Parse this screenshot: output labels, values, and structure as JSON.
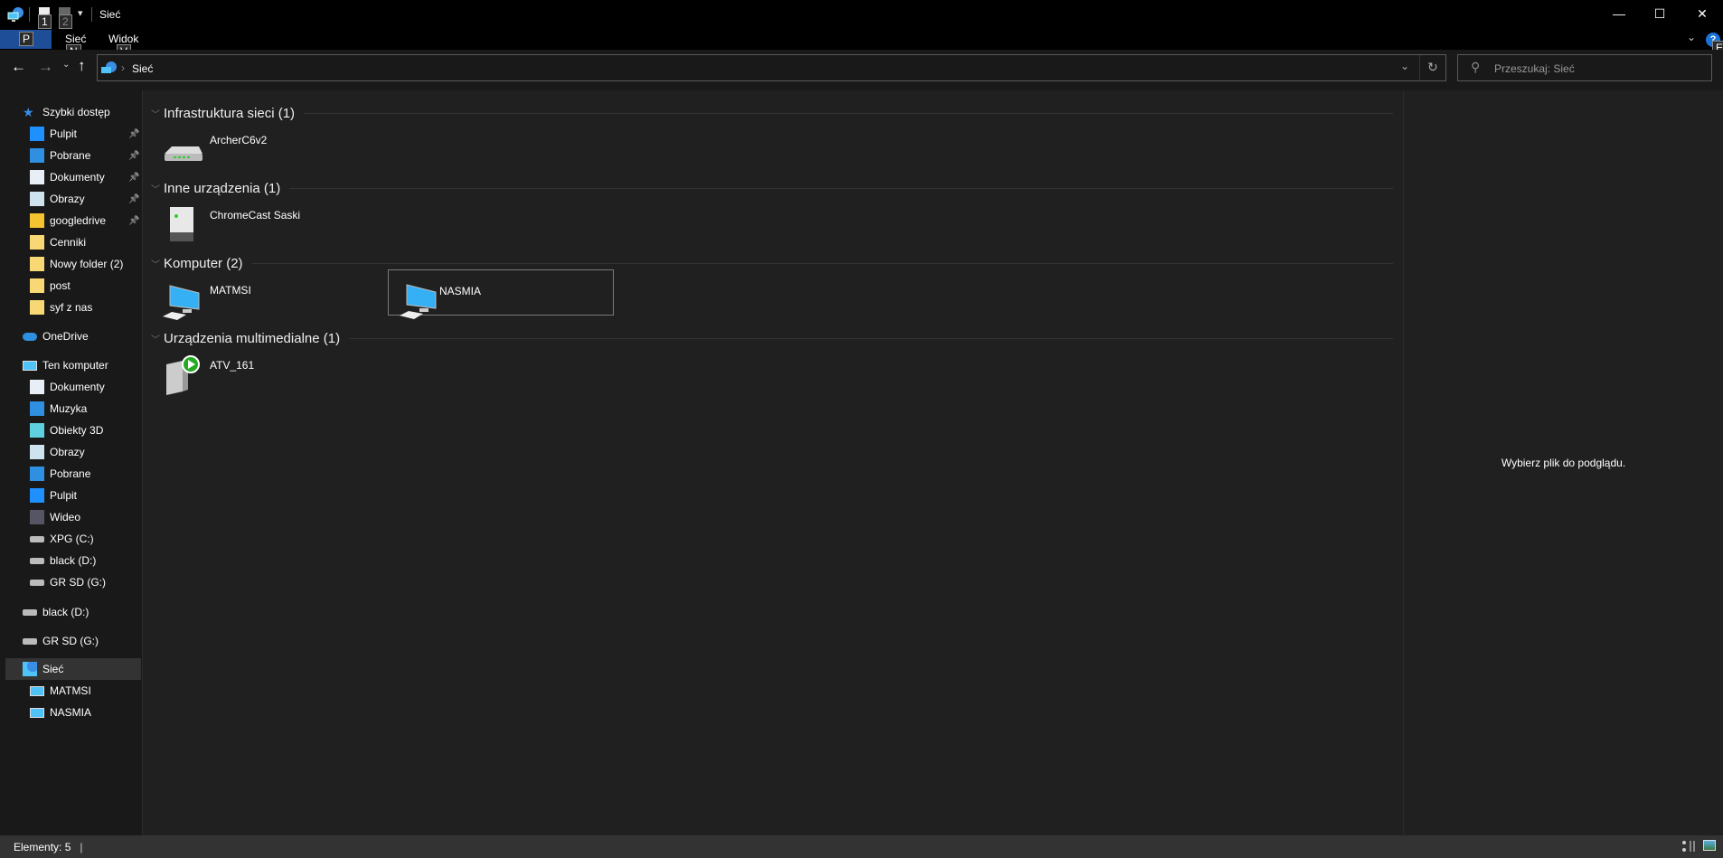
{
  "window": {
    "title": "Sieć",
    "minimize": "—",
    "maximize": "☐",
    "close": "✕"
  },
  "quick_access_toolbar": {
    "keytips": [
      "1",
      "2"
    ]
  },
  "ribbon": {
    "file_tab": "P",
    "tabs": [
      {
        "label": "Sieć",
        "keytip": "N"
      },
      {
        "label": "Widok",
        "keytip": "V"
      }
    ],
    "help_keytip": "E"
  },
  "address": {
    "path": "Sieć",
    "search_placeholder": "Przeszukaj: Sieć"
  },
  "sidebar": {
    "quick_access": {
      "label": "Szybki dostęp",
      "items": [
        {
          "label": "Pulpit",
          "icon": "desktop-icon",
          "pinned": true
        },
        {
          "label": "Pobrane",
          "icon": "download-icon",
          "pinned": true
        },
        {
          "label": "Dokumenty",
          "icon": "documents-icon",
          "pinned": true
        },
        {
          "label": "Obrazy",
          "icon": "pictures-icon",
          "pinned": true
        },
        {
          "label": "googledrive",
          "icon": "google-drive-icon",
          "pinned": true
        },
        {
          "label": "Cenniki",
          "icon": "folder-synced-icon",
          "pinned": false
        },
        {
          "label": "Nowy folder (2)",
          "icon": "folder-icon",
          "pinned": false
        },
        {
          "label": "post",
          "icon": "folder-icon",
          "pinned": false
        },
        {
          "label": "syf z nas",
          "icon": "folder-icon",
          "pinned": false
        }
      ]
    },
    "onedrive": "OneDrive",
    "this_pc": {
      "label": "Ten komputer",
      "items": [
        {
          "label": "Dokumenty",
          "icon": "documents-icon"
        },
        {
          "label": "Muzyka",
          "icon": "music-icon"
        },
        {
          "label": "Obiekty 3D",
          "icon": "3d-objects-icon"
        },
        {
          "label": "Obrazy",
          "icon": "pictures-icon"
        },
        {
          "label": "Pobrane",
          "icon": "download-icon"
        },
        {
          "label": "Pulpit",
          "icon": "desktop-icon"
        },
        {
          "label": "Wideo",
          "icon": "video-icon"
        },
        {
          "label": "XPG (C:)",
          "icon": "system-drive-icon"
        },
        {
          "label": "black (D:)",
          "icon": "drive-icon"
        },
        {
          "label": "GR SD (G:)",
          "icon": "drive-icon"
        }
      ]
    },
    "drives": [
      "black (D:)",
      "GR SD (G:)"
    ],
    "network": {
      "label": "Sieć",
      "items": [
        "MATMSI",
        "NASMIA"
      ]
    }
  },
  "groups": [
    {
      "title": "Infrastruktura sieci (1)",
      "items": [
        {
          "name": "ArcherC6v2",
          "icon": "router-icon"
        }
      ]
    },
    {
      "title": "Inne urządzenia (1)",
      "items": [
        {
          "name": "ChromeCast Saski",
          "icon": "device-icon"
        }
      ]
    },
    {
      "title": "Komputer (2)",
      "items": [
        {
          "name": "MATMSI",
          "icon": "computer-icon"
        },
        {
          "name": "NASMIA",
          "icon": "computer-icon",
          "selected": true
        }
      ]
    },
    {
      "title": "Urządzenia multimedialne (1)",
      "items": [
        {
          "name": "ATV_161",
          "icon": "media-device-icon"
        }
      ]
    }
  ],
  "preview": {
    "text": "Wybierz plik do podglądu."
  },
  "status": {
    "count": "Elementy: 5"
  },
  "colors": {
    "accent": "#1f4e99",
    "selection_border": "#7a7a7a",
    "background": "#202020"
  }
}
